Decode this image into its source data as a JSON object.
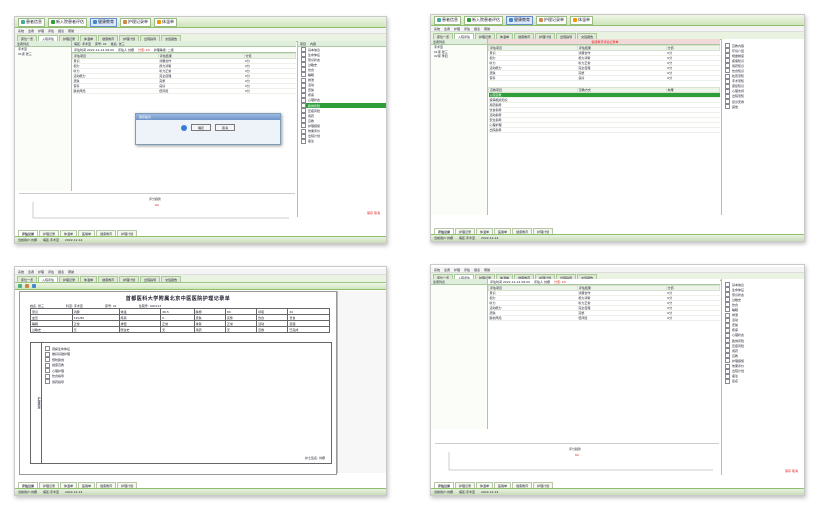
{
  "panel1": {
    "toolbar": [
      "患者信息",
      "新入院患者评估",
      "健康教育",
      "护理记录单",
      "体温单"
    ],
    "menu": [
      "系统",
      "患者",
      "护理",
      "评估",
      "报表",
      "帮助"
    ],
    "tabs": [
      "床位一览",
      "入院评估",
      "护理记录",
      "体温单",
      "健康教育",
      "护理计划",
      "出院指导",
      "交班报告"
    ],
    "record_header": [
      "病区: 手术室",
      "床号: 01",
      "姓名: 张三"
    ],
    "record_meta": [
      "评估时间 2022-12-14 08:00",
      "评估人 刘娜",
      "分值: 60",
      "护理等级: 二级"
    ],
    "table_headers": [
      "评估项目",
      "评估结果",
      "分值"
    ],
    "rows": [
      [
        "意识",
        "清醒合作",
        "0分"
      ],
      [
        "视力",
        "视力清晰",
        "0分"
      ],
      [
        "听力",
        "听力正常",
        "0分"
      ],
      [
        "活动能力",
        "完全自理",
        "0分"
      ],
      [
        "皮肤",
        "完整",
        "0分"
      ],
      [
        "营养",
        "良好",
        "0分"
      ],
      [
        "跌倒风险",
        "低风险",
        "0分"
      ]
    ],
    "right_header": [
      "项目",
      "内容"
    ],
    "right_items": [
      "基本信息",
      "生命体征",
      "意识状态",
      "过敏史",
      "饮食",
      "睡眠",
      "排泄",
      "活动",
      "皮肤",
      "疼痛",
      "心理状态",
      "跌倒风险",
      "压疮风险",
      "用药",
      "宣教",
      "护理措施",
      "效果评价",
      "出院计划",
      "备注"
    ],
    "right_selected": "跌倒风险",
    "dialog": {
      "title": "保存提示",
      "ok": "确定",
      "cancel": "取消"
    },
    "chart_title": "评分趋势",
    "chart_red_label": "60",
    "bottom_tabs": [
      "评估记录",
      "护理记录",
      "体温单",
      "医嘱单",
      "健康教育",
      "护理计划"
    ],
    "status": [
      "当前用户:刘娜",
      "病区:手术室",
      "2022-12-14"
    ],
    "footer_red": "保存 取消"
  },
  "panel2": {
    "toolbar": [
      "患者信息",
      "新入院患者评估",
      "健康教育",
      "护理记录单",
      "体温单"
    ],
    "menu": [
      "系统",
      "患者",
      "护理",
      "评估",
      "报表",
      "帮助"
    ],
    "tabs": [
      "床位一览",
      "入院评估",
      "护理记录",
      "体温单",
      "健康教育",
      "护理计划",
      "出院指导",
      "交班报告"
    ],
    "title_bar": "健康教育评估记录单",
    "left_tree": [
      "患者列表",
      "手术室",
      "01床 张三",
      "02床 李四"
    ],
    "table_headers": [
      "评估项目",
      "评估结果",
      "分值"
    ],
    "rows": [
      [
        "意识",
        "清醒合作",
        "0分"
      ],
      [
        "视力",
        "视力清晰",
        "0分"
      ],
      [
        "听力",
        "听力正常",
        "0分"
      ],
      [
        "活动能力",
        "完全自理",
        "0分"
      ],
      [
        "皮肤",
        "完整",
        "0分"
      ],
      [
        "营养",
        "良好",
        "0分"
      ]
    ],
    "list_headers": [
      "宣教项目",
      "宣教方式",
      "效果"
    ],
    "list_rows": [
      "入院宣教",
      "疾病相关知识",
      "用药指导",
      "饮食指导",
      "活动指导",
      "安全指导",
      "心理护理",
      "出院指导"
    ],
    "selected_row": "入院宣教",
    "right_tree": [
      "宣教内容",
      "环境介绍",
      "规章制度",
      "疾病知识",
      "用药知识",
      "饮食知识",
      "检查须知",
      "手术须知",
      "康复知识",
      "心理支持",
      "出院须知",
      "复诊安排",
      "其他"
    ],
    "bottom_tabs": [
      "评估记录",
      "护理记录",
      "体温单",
      "医嘱单",
      "健康教育",
      "护理计划"
    ],
    "status": [
      "当前用户:刘娜",
      "病区:手术室",
      "2022-12-14"
    ]
  },
  "panel3": {
    "menu": [
      "系统",
      "患者",
      "护理",
      "评估",
      "报表",
      "帮助"
    ],
    "tabs": [
      "床位一览",
      "入院评估",
      "护理记录",
      "体温单",
      "健康教育",
      "护理计划",
      "出院指导",
      "交班报告"
    ],
    "doc_title": "首都医科大学附属北京中医医院护理记录单",
    "form_header": [
      "姓名: 张三",
      "科室: 手术室",
      "床号: 01",
      "住院号: 000123"
    ],
    "grid_rows": [
      [
        "意识",
        "清醒",
        "体温",
        "36.5",
        "脉搏",
        "80",
        "呼吸",
        "20"
      ],
      [
        "血压",
        "120/80",
        "疼痛",
        "0",
        "皮肤",
        "完整",
        "饮食",
        "普食"
      ],
      [
        "睡眠",
        "正常",
        "排便",
        "正常",
        "排尿",
        "正常",
        "活动",
        "自理"
      ],
      [
        "过敏史",
        "无",
        "既往史",
        "无",
        "用药",
        "无",
        "宣教",
        "已完成"
      ]
    ],
    "section_labels": [
      "护理评估",
      "护理措施",
      "效果评价"
    ],
    "measures": [
      "观察生命体征",
      "做好基础护理",
      "预防跌倒",
      "健康宣教",
      "心理护理",
      "饮食指导",
      "用药指导"
    ],
    "sign": "护士签名: 刘娜",
    "bottom_tabs": [
      "评估记录",
      "护理记录",
      "体温单",
      "医嘱单",
      "健康教育",
      "护理计划"
    ],
    "status": [
      "当前用户:刘娜",
      "病区:手术室",
      "2022-12-14"
    ]
  },
  "panel4": {
    "menu": [
      "系统",
      "患者",
      "护理",
      "评估",
      "报表",
      "帮助"
    ],
    "tabs": [
      "床位一览",
      "入院评估",
      "护理记录",
      "体温单",
      "健康教育",
      "护理计划",
      "出院指导",
      "交班报告"
    ],
    "record_meta": [
      "评估时间 2022-12-14 08:00",
      "评估人 刘娜",
      "分值: 60"
    ],
    "table_headers": [
      "评估项目",
      "评估结果",
      "分值"
    ],
    "rows": [
      [
        "意识",
        "清醒合作",
        "0分"
      ],
      [
        "视力",
        "视力清晰",
        "0分"
      ],
      [
        "听力",
        "听力正常",
        "0分"
      ],
      [
        "活动能力",
        "完全自理",
        "0分"
      ],
      [
        "皮肤",
        "完整",
        "0分"
      ],
      [
        "跌倒风险",
        "低风险",
        "0分"
      ]
    ],
    "right_items": [
      "基本信息",
      "生命体征",
      "意识状态",
      "过敏史",
      "饮食",
      "睡眠",
      "排泄",
      "活动",
      "皮肤",
      "疼痛",
      "心理状态",
      "跌倒风险",
      "压疮风险",
      "用药",
      "宣教",
      "护理措施",
      "效果评价",
      "出院计划",
      "备注",
      "签名"
    ],
    "chart_title": "评分趋势",
    "chart_red_label": "60",
    "bottom_tabs": [
      "评估记录",
      "护理记录",
      "体温单",
      "医嘱单",
      "健康教育",
      "护理计划"
    ],
    "status": [
      "当前用户:刘娜",
      "病区:手术室",
      "2022-12-14"
    ],
    "footer_red": "保存 取消"
  },
  "colors": {
    "accent_green": "#2e9e3a",
    "header_green": "#cfe4bc",
    "dialog_blue": "#6f94c8",
    "alert_red": "#d22"
  }
}
